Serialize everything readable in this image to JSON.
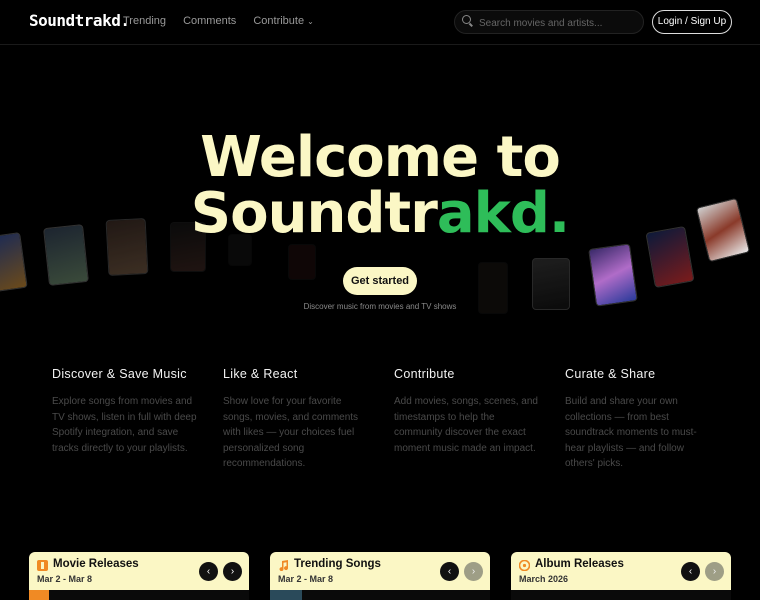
{
  "nav": {
    "logo": "Soundtrakd.",
    "links": [
      "Trending",
      "Comments",
      "Contribute"
    ],
    "search_placeholder": "Search movies and artists...",
    "login": "Login / Sign Up"
  },
  "hero": {
    "line1": "Welcome to",
    "line2a": "Soundtr",
    "line2b": "akd.",
    "cta": "Get started",
    "subtitle": "Discover music from movies and TV shows"
  },
  "features": [
    {
      "title": "Discover & Save Music",
      "text": "Explore songs from movies and TV shows, listen in full with deep Spotify integration, and save tracks directly to your playlists."
    },
    {
      "title": "Like & React",
      "text": "Show love for your favorite songs, movies, and comments with likes — your choices fuel personalized song recommendations."
    },
    {
      "title": "Contribute",
      "text": "Add movies, songs, scenes, and timestamps to help the community discover the exact moment music made an impact."
    },
    {
      "title": "Curate & Share",
      "text": "Build and share your own collections — from best soundtrack moments to must-hear playlists — and follow others' picks."
    }
  ],
  "cards": [
    {
      "title": "Movie Releases",
      "date": "Mar 2 - Mar 8"
    },
    {
      "title": "Trending Songs",
      "date": "Mar 2 - Mar 8"
    },
    {
      "title": "Album Releases",
      "date": "March 2026"
    }
  ],
  "colors": {
    "accent": "#2ebd59",
    "cream": "#fbf7c5",
    "orange": "#f08a24"
  }
}
